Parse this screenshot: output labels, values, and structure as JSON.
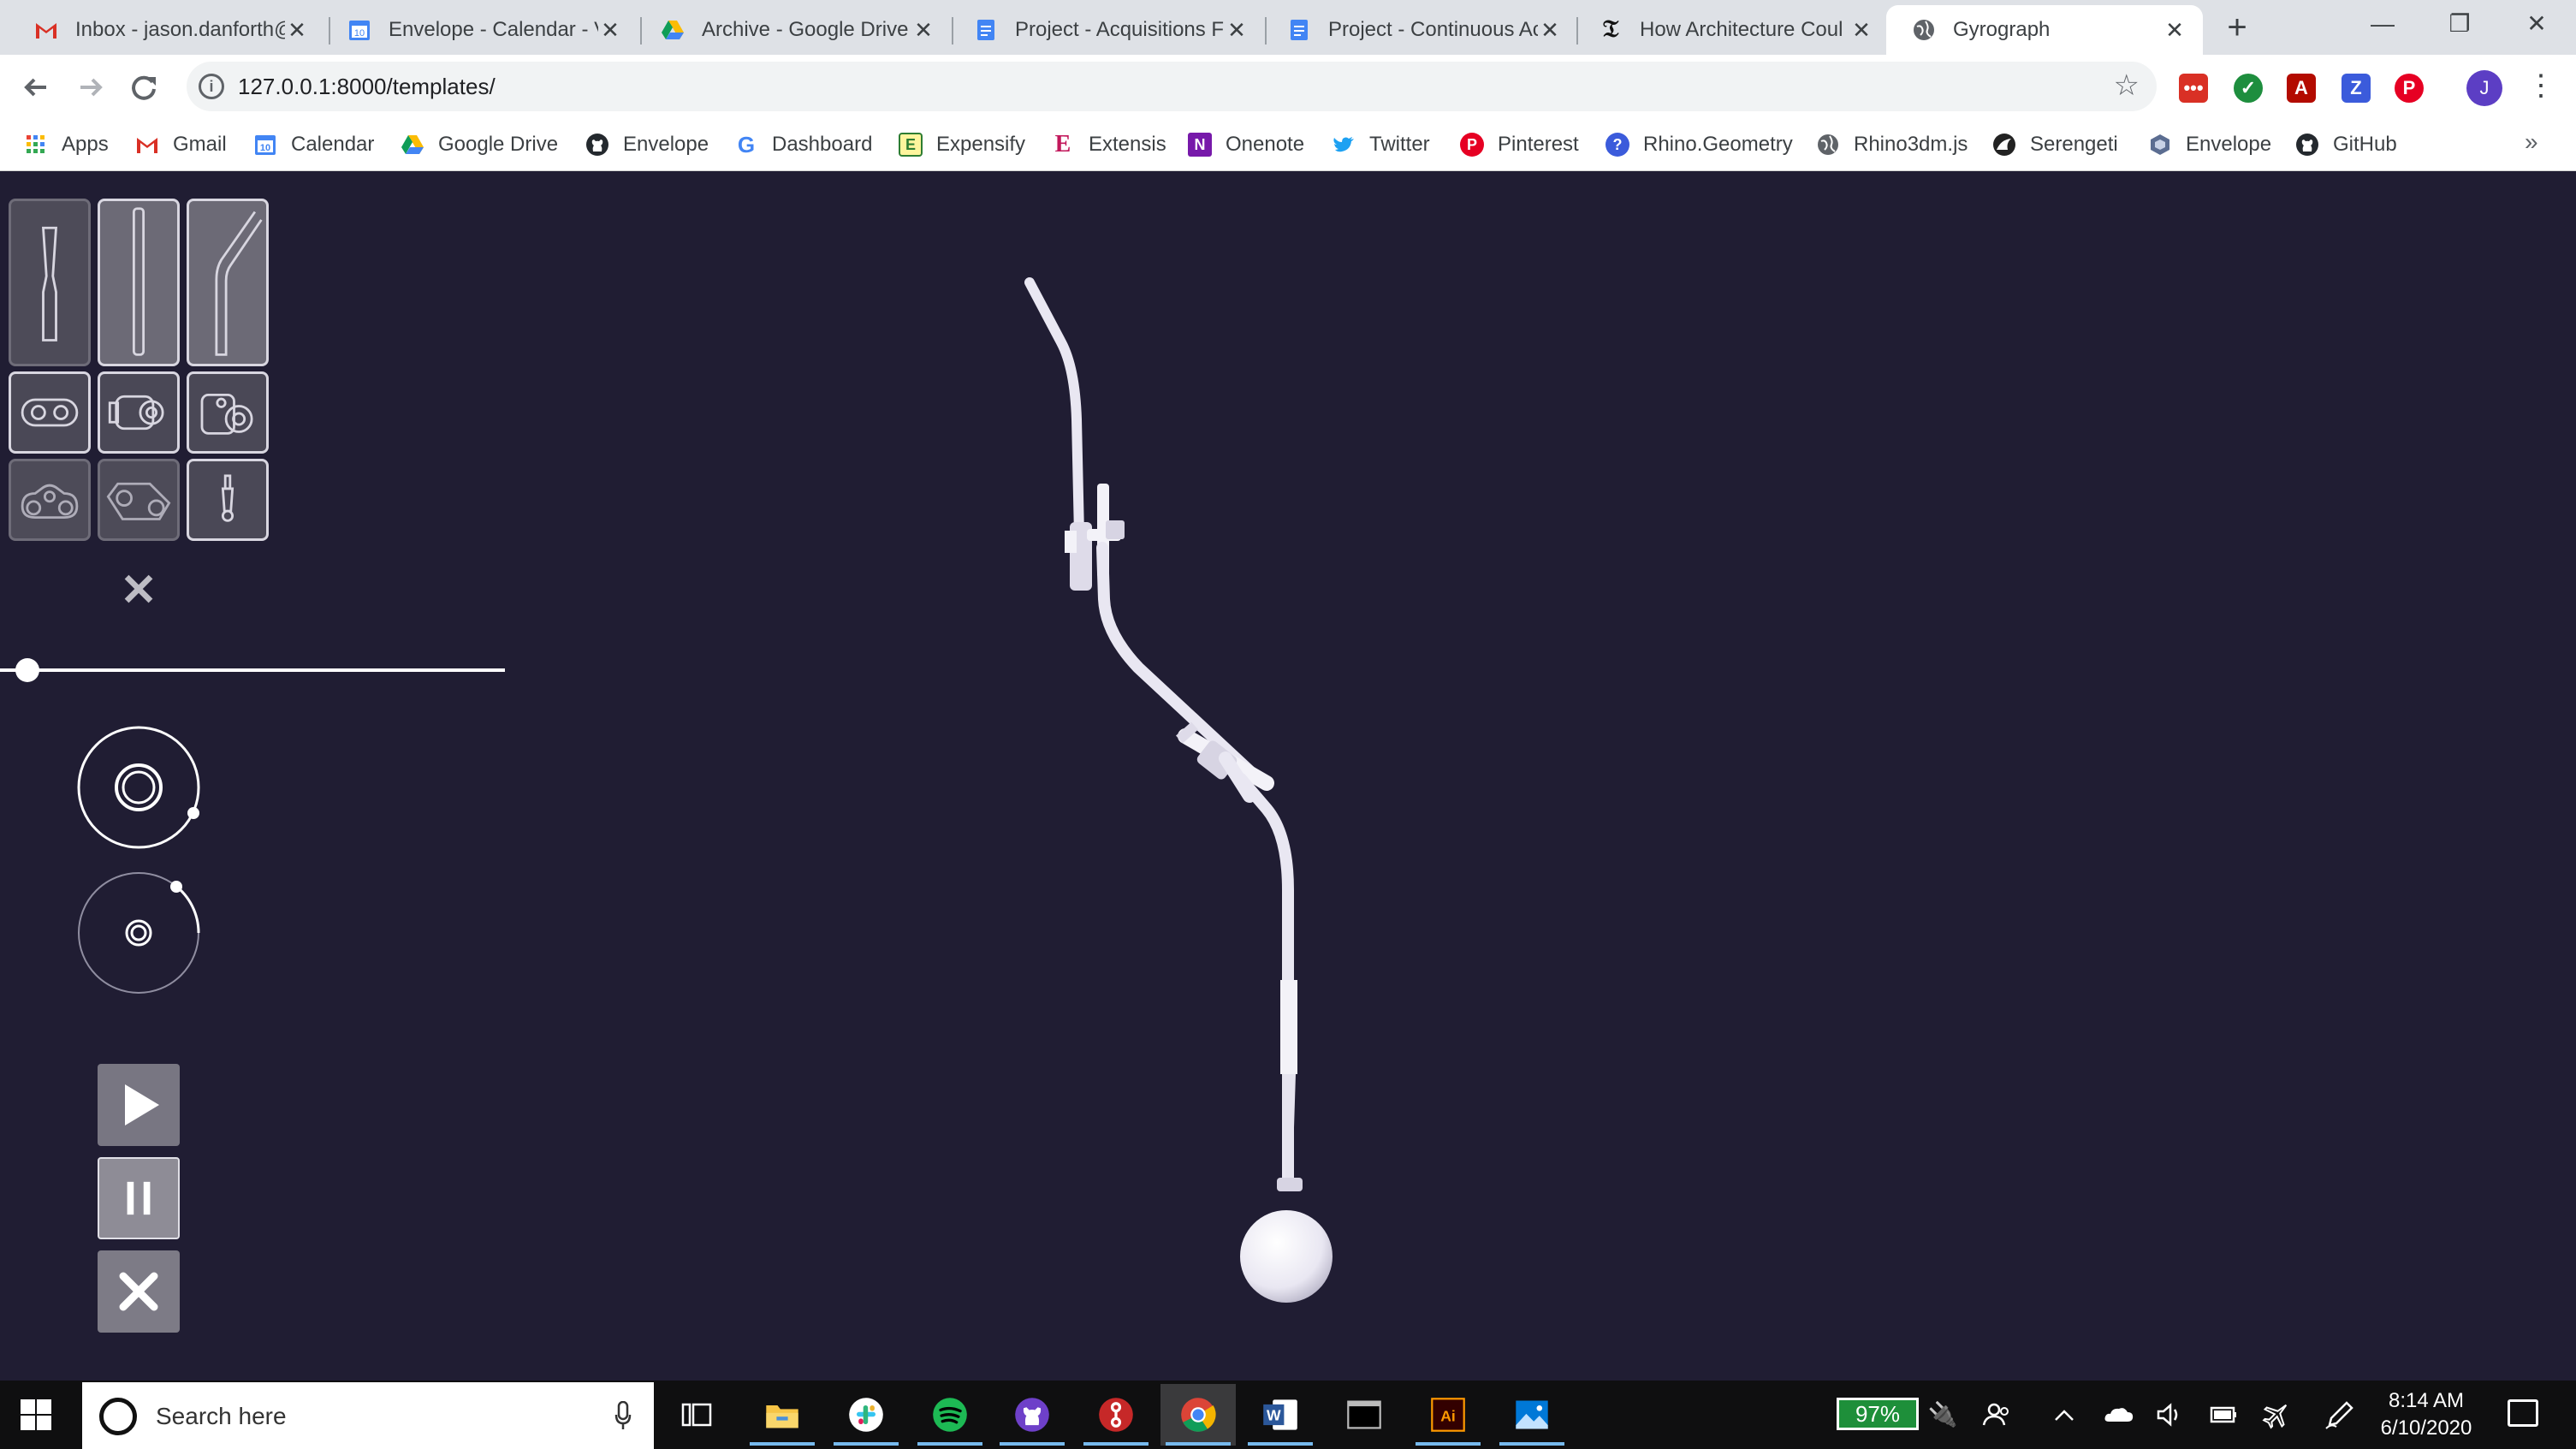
{
  "browser": {
    "tabs": [
      {
        "title": "Inbox - jason.danforth@",
        "icon": "gmail-icon"
      },
      {
        "title": "Envelope - Calendar - V",
        "icon": "calendar-icon"
      },
      {
        "title": "Archive - Google Drive",
        "icon": "google-drive-icon"
      },
      {
        "title": "Project - Acquisitions F",
        "icon": "google-docs-icon"
      },
      {
        "title": "Project - Continuous Ac",
        "icon": "google-docs-icon"
      },
      {
        "title": "How Architecture Coul",
        "icon": "nyt-icon"
      },
      {
        "title": "Gyrograph",
        "icon": "globe-icon",
        "active": true
      }
    ],
    "new_tab_glyph": "+",
    "window": {
      "minimize": "—",
      "restore": "❐",
      "close": "✕"
    },
    "url": "127.0.0.1:8000/templates/",
    "profile_initial": "J",
    "bookmarks": [
      {
        "label": "Apps",
        "icon": "apps-grid-icon"
      },
      {
        "label": "Gmail",
        "icon": "gmail-icon"
      },
      {
        "label": "Calendar",
        "icon": "calendar-icon"
      },
      {
        "label": "Google Drive",
        "icon": "google-drive-icon"
      },
      {
        "label": "Envelope",
        "icon": "github-icon"
      },
      {
        "label": "Dashboard",
        "icon": "google-icon"
      },
      {
        "label": "Expensify",
        "icon": "expensify-icon"
      },
      {
        "label": "Extensis",
        "icon": "extensis-icon"
      },
      {
        "label": "Onenote",
        "icon": "onenote-icon"
      },
      {
        "label": "Twitter",
        "icon": "twitter-icon"
      },
      {
        "label": "Pinterest",
        "icon": "pinterest-icon"
      },
      {
        "label": "Rhino.Geometry",
        "icon": "question-icon"
      },
      {
        "label": "Rhino3dm.js",
        "icon": "globe-icon"
      },
      {
        "label": "Serengeti",
        "icon": "serengeti-icon"
      },
      {
        "label": "Envelope",
        "icon": "envelope-hex-icon"
      },
      {
        "label": "GitHub",
        "icon": "github-icon"
      }
    ],
    "bookmarks_overflow": "»"
  },
  "app": {
    "title": "Gyrograph",
    "close_glyph": "✕",
    "slider_value": 0.05,
    "tool_palette": [
      {
        "name": "tool-straight-tapered-arm",
        "state": "dim"
      },
      {
        "name": "tool-straight-tube",
        "state": "normal"
      },
      {
        "name": "tool-bent-tube",
        "state": "normal"
      },
      {
        "name": "tool-double-ring-joint",
        "state": "normal"
      },
      {
        "name": "tool-motor-joint",
        "state": "normal"
      },
      {
        "name": "tool-pulley-joint",
        "state": "normal"
      },
      {
        "name": "tool-triple-gear",
        "state": "dim"
      },
      {
        "name": "tool-belt-drive",
        "state": "dim"
      },
      {
        "name": "tool-pen-holder",
        "state": "normal"
      }
    ],
    "colors": {
      "background": "#201d33",
      "accent": "#ffffff",
      "model": "#e9e7f2"
    }
  },
  "taskbar": {
    "search_placeholder": "Search here",
    "apps": [
      "task-view-icon",
      "file-explorer-icon",
      "slack-icon",
      "spotify-icon",
      "github-desktop-icon",
      "git-icon",
      "chrome-icon",
      "word-icon",
      "terminal-icon",
      "illustrator-icon",
      "photos-icon"
    ],
    "battery": "97%",
    "time": "8:14 AM",
    "date": "6/10/2020"
  }
}
